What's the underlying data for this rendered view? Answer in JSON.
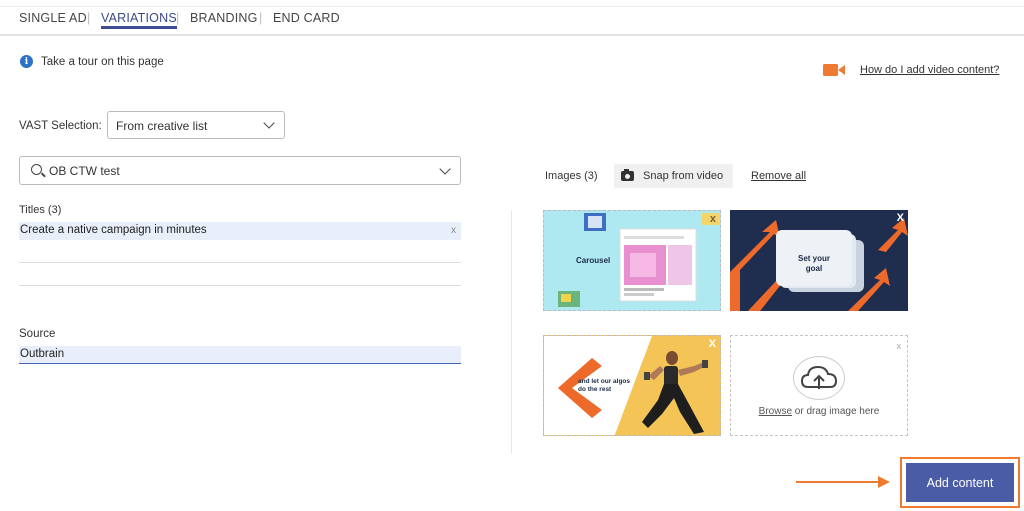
{
  "tabs": [
    {
      "label": "SINGLE AD",
      "active": false
    },
    {
      "label": "VARIATIONS",
      "active": true
    },
    {
      "label": "BRANDING",
      "active": false
    },
    {
      "label": "END CARD",
      "active": false
    }
  ],
  "tab_separator": "|",
  "tour": {
    "icon": "info-icon",
    "label": "Take a tour on this page"
  },
  "video_help": {
    "icon": "video-camera-icon",
    "label": "How do I add video content?"
  },
  "vast": {
    "label": "VAST Selection:",
    "value": "From creative list"
  },
  "search": {
    "value": "OB CTW test"
  },
  "titles": {
    "label": "Titles (3)",
    "items": [
      "Create a native campaign in minutes",
      "",
      ""
    ],
    "remove_label": "x"
  },
  "source": {
    "label": "Source",
    "value": "Outbrain"
  },
  "images": {
    "label": "Images (3)",
    "snap_label": "Snap from video",
    "remove_all": "Remove all",
    "thumbs": [
      {
        "caption": "Carousel",
        "close": "x"
      },
      {
        "caption_line1": "Set your",
        "caption_line2": "goal",
        "close": "X"
      },
      {
        "caption_line1": "and let our algos",
        "caption_line2": "do the rest",
        "close": "X"
      }
    ],
    "upload": {
      "browse": "Browse",
      "rest": " or drag image here",
      "close": "x"
    }
  },
  "add_content": "Add content",
  "colors": {
    "accent": "#4a5ca6",
    "highlight": "#ef7a32",
    "info": "#2d72c7"
  }
}
